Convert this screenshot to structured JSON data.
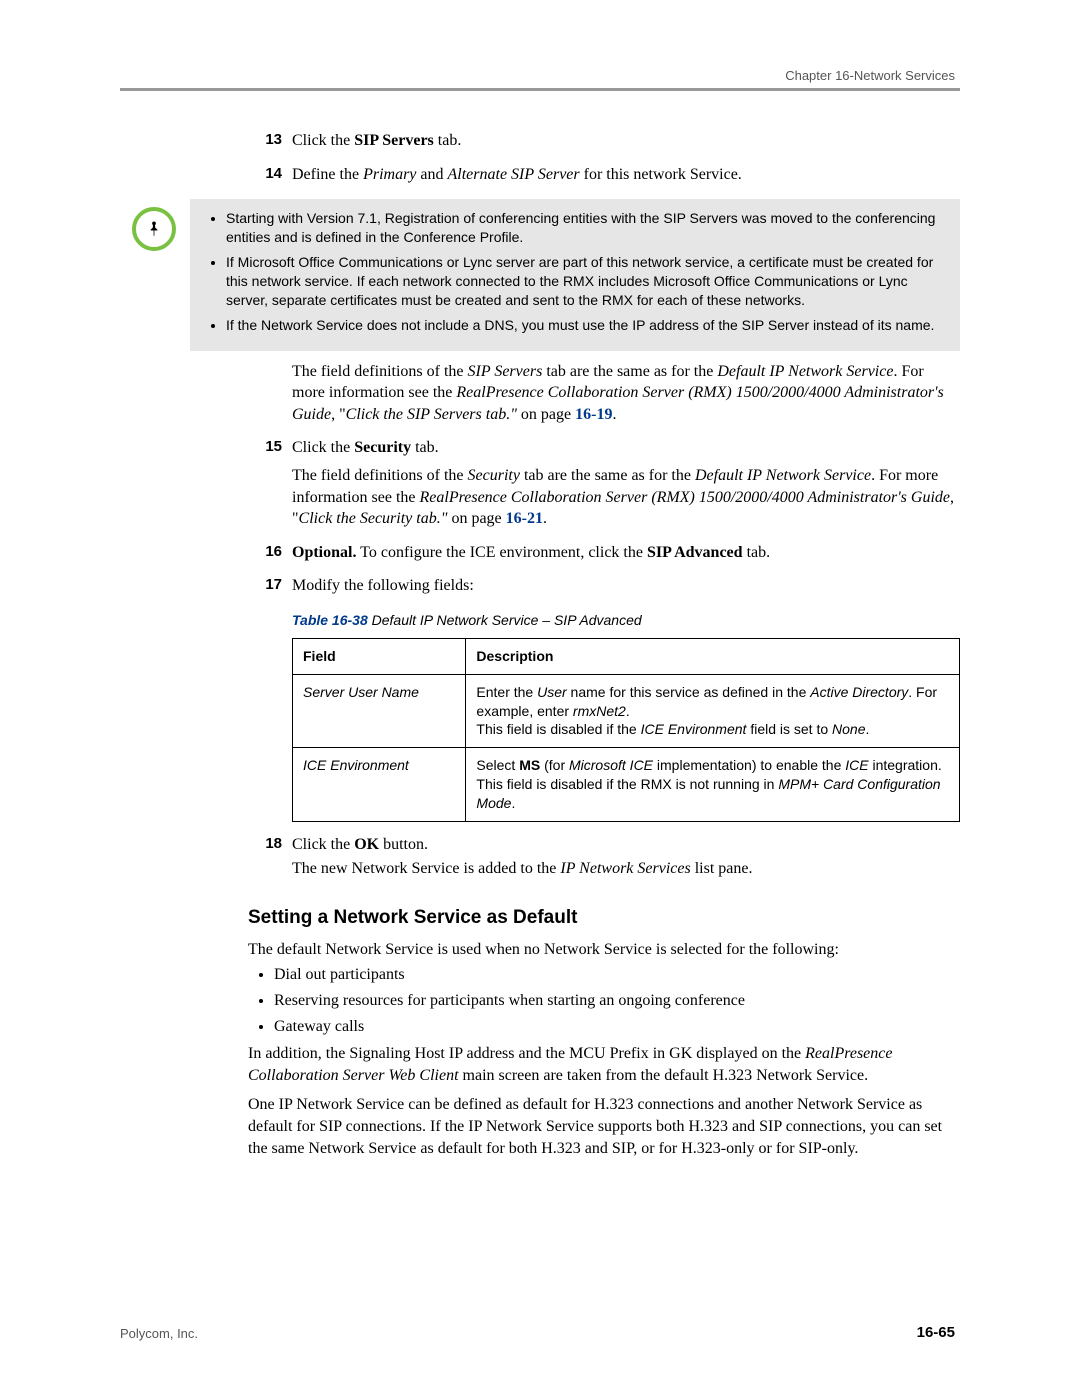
{
  "header": {
    "chapter": "Chapter 16-Network Services"
  },
  "steps": {
    "s13": {
      "num": "13",
      "a": "Click the ",
      "b_bold": "SIP Servers",
      "c": " tab."
    },
    "s14": {
      "num": "14",
      "a": "Define the ",
      "b_it": "Primary ",
      "c": "and ",
      "d_it": "Alternate SIP Server",
      "e": " for this network Service."
    },
    "note": {
      "b1": "Starting with Version 7.1, Registration of conferencing entities with the SIP Servers was moved to the conferencing entities and is defined in the Conference Profile.",
      "b2": "If Microsoft Office Communications or Lync server are part of this network service, a certificate must be created for this network service. If each network connected to the RMX includes Microsoft Office Communications or Lync server, separate certificates must be created and sent to the RMX for each of these networks.",
      "b3": "If the Network Service does not include a DNS, you must use the IP address of the SIP Server instead of its name."
    },
    "after14": {
      "p1a": "The field definitions of the ",
      "p1b_it": "SIP Servers",
      "p1c": " tab are the same as for the ",
      "p1d_it": "Default IP Network Service",
      "p1e": ". For more information see the ",
      "p1f_it": "RealPresence Collaboration Server (RMX) 1500/2000/4000 Administrator's Guide",
      "p1g": ", \"",
      "p1h_it": "Click the SIP Servers tab.\"",
      "p1i": " on page ",
      "p1j_ref": "16-19",
      "p1k": "."
    },
    "s15": {
      "num": "15",
      "a": "Click the ",
      "b_bold": "Security",
      "c": " tab.",
      "p1a": "The field definitions of the ",
      "p1b_it": "Security",
      "p1c": " tab are the same as for the ",
      "p1d_it": "Default IP Network Service",
      "p1e": ". For more information see the ",
      "p1f_it": "RealPresence Collaboration Server (RMX) 1500/2000/4000 Administrator's Guide",
      "p1g": ", \"",
      "p1h_it": "Click the Security tab.\"",
      "p1i": " on page ",
      "p1j_ref": "16-21",
      "p1k": "."
    },
    "s16": {
      "num": "16",
      "a_bold": "Optional.",
      "b": " To configure the ICE environment, click the ",
      "c_bold": "SIP Advanced",
      "d": " tab."
    },
    "s17": {
      "num": "17",
      "a": " Modify the following fields:"
    },
    "s18": {
      "num": "18",
      "a": "Click the ",
      "b_bold": "OK",
      "c": " button.",
      "p1a": "The new Network Service is added to the ",
      "p1b_it": "IP Network Services",
      "p1c": " list pane."
    }
  },
  "table": {
    "caption_num": "Table 16-38",
    "caption_title": " Default IP Network Service – SIP Advanced",
    "head_field": "Field",
    "head_desc": "Description",
    "rows": [
      {
        "field": "Server User Name",
        "d1a": "Enter the ",
        "d1b_it": "User",
        "d1c": " name for this service as defined in the ",
        "d1d_it": "Active Directory",
        "d1e": ". For example, enter ",
        "d1f_it": "rmxNet2",
        "d1g": ".",
        "d2a": "This field is disabled if the ",
        "d2b_it": "ICE Environment",
        "d2c": " field is set to ",
        "d2d_it": "None",
        "d2e": "."
      },
      {
        "field": "ICE Environment",
        "d1a": "Select ",
        "d1b_bold": "MS",
        "d1c": " (for ",
        "d1d_it": "Microsoft ICE",
        "d1e": " implementation) to enable the ",
        "d1f_it": "ICE",
        "d1g": " integration.",
        "d2a": "This field is disabled if the RMX is not running in ",
        "d2b_it": "MPM+ Card Configuration Mode",
        "d2c": "."
      }
    ]
  },
  "section": {
    "heading": "Setting a Network Service as Default",
    "p1": "The default Network Service is used when no Network Service is selected for the following:",
    "bullets": [
      "Dial out participants",
      "Reserving resources for participants when starting an ongoing conference",
      "Gateway calls"
    ],
    "p2a": "In addition, the Signaling Host IP address and the MCU Prefix in GK displayed on the ",
    "p2b_it": "RealPresence Collaboration Server Web Client",
    "p2c": " main screen are taken from the default H.323 Network Service.",
    "p3": "One IP Network Service can be defined as default for H.323 connections and another Network Service as default for SIP connections. If the IP Network Service supports both H.323 and SIP connections, you can set the same Network Service as default for both H.323 and SIP, or for H.323-only or for SIP-only."
  },
  "footer": {
    "left": "Polycom, Inc.",
    "right": "16-65"
  }
}
